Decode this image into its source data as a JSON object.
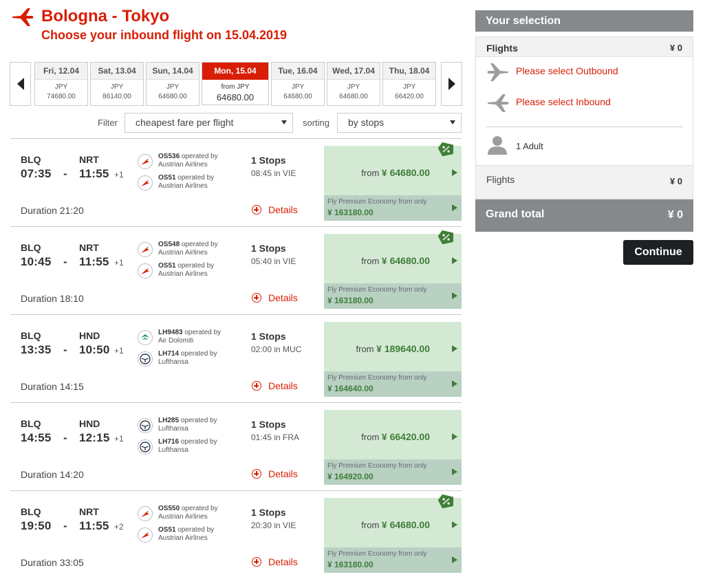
{
  "header": {
    "route": "Bologna - Tokyo",
    "subtitle": "Choose your inbound flight on 15.04.2019"
  },
  "dates": [
    {
      "label": "Fri, 12.04",
      "currency": "JPY",
      "price": "74680.00",
      "active": false
    },
    {
      "label": "Sat, 13.04",
      "currency": "JPY",
      "price": "86140.00",
      "active": false
    },
    {
      "label": "Sun, 14.04",
      "currency": "JPY",
      "price": "64680.00",
      "active": false
    },
    {
      "label": "Mon, 15.04",
      "currency": "from JPY",
      "price": "64680.00",
      "active": true
    },
    {
      "label": "Tue, 16.04",
      "currency": "JPY",
      "price": "64680.00",
      "active": false
    },
    {
      "label": "Wed, 17.04",
      "currency": "JPY",
      "price": "64680.00",
      "active": false
    },
    {
      "label": "Thu, 18.04",
      "currency": "JPY",
      "price": "66420.00",
      "active": false
    }
  ],
  "filters": {
    "filter_label": "Filter",
    "filter_value": "cheapest fare per flight",
    "sorting_label": "sorting",
    "sorting_value": "by stops"
  },
  "flights": [
    {
      "origin": "BLQ",
      "destination": "NRT",
      "depart": "07:35",
      "arrive": "11:55",
      "day_offset": "+1",
      "duration": "Duration 21:20",
      "legs": [
        {
          "flight": "OS536",
          "op": "operated by",
          "carrier": "Austrian Airlines",
          "logo": "austrian-logo-icon"
        },
        {
          "flight": "OS51",
          "op": "operated by",
          "carrier": "Austrian Airlines",
          "logo": "austrian-logo-icon"
        }
      ],
      "stops": "1 Stops",
      "via": "08:45 in VIE",
      "details": "Details",
      "from": "from",
      "price": "¥ 64680.00",
      "premium_text": "Fly Premium Economy from only",
      "premium_price": "¥ 163180.00",
      "discount_tag": true
    },
    {
      "origin": "BLQ",
      "destination": "NRT",
      "depart": "10:45",
      "arrive": "11:55",
      "day_offset": "+1",
      "duration": "Duration 18:10",
      "legs": [
        {
          "flight": "OS548",
          "op": "operated by",
          "carrier": "Austrian Airlines",
          "logo": "austrian-logo-icon"
        },
        {
          "flight": "OS51",
          "op": "operated by",
          "carrier": "Austrian Airlines",
          "logo": "austrian-logo-icon"
        }
      ],
      "stops": "1 Stops",
      "via": "05:40 in VIE",
      "details": "Details",
      "from": "from",
      "price": "¥ 64680.00",
      "premium_text": "Fly Premium Economy from only",
      "premium_price": "¥ 163180.00",
      "discount_tag": true
    },
    {
      "origin": "BLQ",
      "destination": "HND",
      "depart": "13:35",
      "arrive": "10:50",
      "day_offset": "+1",
      "duration": "Duration 14:15",
      "legs": [
        {
          "flight": "LH9483",
          "op": "operated by",
          "carrier": "Air Dolomiti",
          "logo": "air-dolomiti-logo-icon"
        },
        {
          "flight": "LH714",
          "op": "operated by",
          "carrier": "Lufthansa",
          "logo": "lufthansa-logo-icon"
        }
      ],
      "stops": "1 Stops",
      "via": "02:00 in MUC",
      "details": "Details",
      "from": "from",
      "price": "¥ 189640.00",
      "premium_text": "Fly Premium Economy from only",
      "premium_price": "¥ 164640.00",
      "discount_tag": false
    },
    {
      "origin": "BLQ",
      "destination": "HND",
      "depart": "14:55",
      "arrive": "12:15",
      "day_offset": "+1",
      "duration": "Duration 14:20",
      "legs": [
        {
          "flight": "LH285",
          "op": "operated by",
          "carrier": "Lufthansa",
          "logo": "lufthansa-logo-icon"
        },
        {
          "flight": "LH716",
          "op": "operated by",
          "carrier": "Lufthansa",
          "logo": "lufthansa-logo-icon"
        }
      ],
      "stops": "1 Stops",
      "via": "01:45 in FRA",
      "details": "Details",
      "from": "from",
      "price": "¥ 66420.00",
      "premium_text": "Fly Premium Economy from only",
      "premium_price": "¥ 164920.00",
      "discount_tag": false
    },
    {
      "origin": "BLQ",
      "destination": "NRT",
      "depart": "19:50",
      "arrive": "11:55",
      "day_offset": "+2",
      "duration": "Duration 33:05",
      "legs": [
        {
          "flight": "OS550",
          "op": "operated by",
          "carrier": "Austrian Airlines",
          "logo": "austrian-logo-icon"
        },
        {
          "flight": "OS51",
          "op": "operated by",
          "carrier": "Austrian Airlines",
          "logo": "austrian-logo-icon"
        }
      ],
      "stops": "1 Stops",
      "via": "20:30 in VIE",
      "details": "Details",
      "from": "from",
      "price": "¥ 64680.00",
      "premium_text": "Fly Premium Economy from only",
      "premium_price": "¥ 163180.00",
      "discount_tag": true
    }
  ],
  "selection": {
    "title": "Your selection",
    "flights_label": "Flights",
    "flights_value": "¥ 0",
    "outbound": "Please select Outbound",
    "inbound": "Please select Inbound",
    "passengers": "1 Adult",
    "summary_label": "Flights",
    "summary_value": "¥ 0",
    "grand_label": "Grand total",
    "grand_value": "¥ 0",
    "continue_label": "Continue"
  },
  "colors": {
    "brand_red": "#d81e05",
    "fare_green": "#d4e9d4",
    "premium_green": "#b8d1c2",
    "price_green": "#3f7e39",
    "panel_gray": "#85898c"
  }
}
